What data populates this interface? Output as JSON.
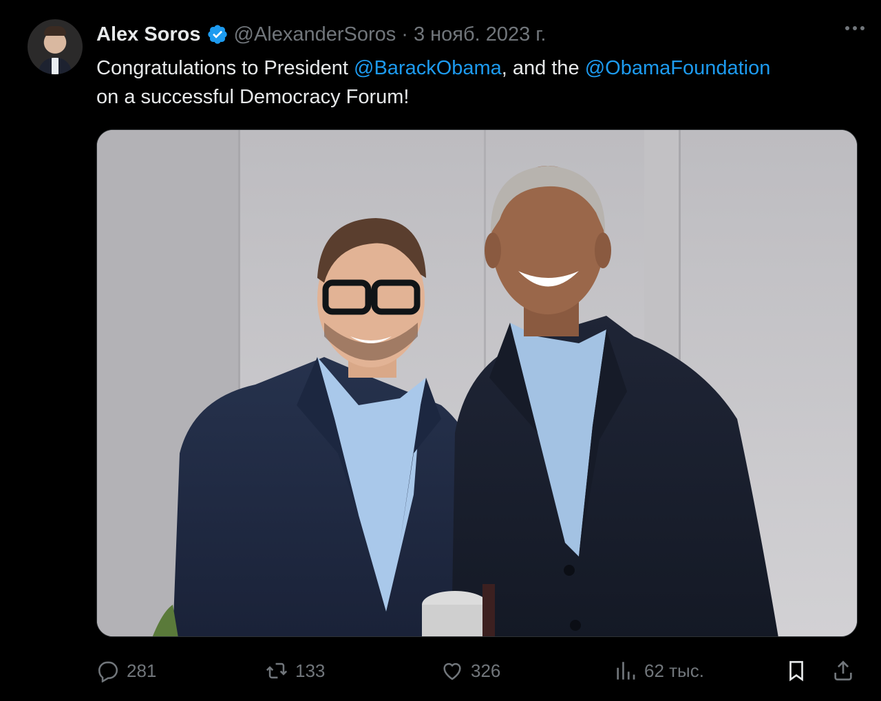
{
  "author": {
    "display_name": "Alex Soros",
    "handle": "@AlexanderSoros",
    "separator": "·",
    "date": "3 нояб. 2023 г.",
    "verified": true
  },
  "tweet": {
    "text_start": "Congratulations to President ",
    "mention_1": "@BarackObama",
    "text_middle": ", and the ",
    "mention_2": "@ObamaFoundation",
    "text_end": " on a successful Democracy Forum!"
  },
  "stats": {
    "replies": "281",
    "retweets": "133",
    "likes": "326",
    "views": "62 тыс."
  },
  "icons": {
    "reply": "reply-icon",
    "retweet": "retweet-icon",
    "like": "heart-icon",
    "views": "views-icon",
    "bookmark": "bookmark-icon",
    "share": "share-icon",
    "more": "more-icon",
    "verified": "verified-badge-icon"
  },
  "colors": {
    "background": "#000000",
    "text": "#e7e9ea",
    "muted": "#71767b",
    "link": "#1d9bf0",
    "verified": "#1d9bf0"
  }
}
